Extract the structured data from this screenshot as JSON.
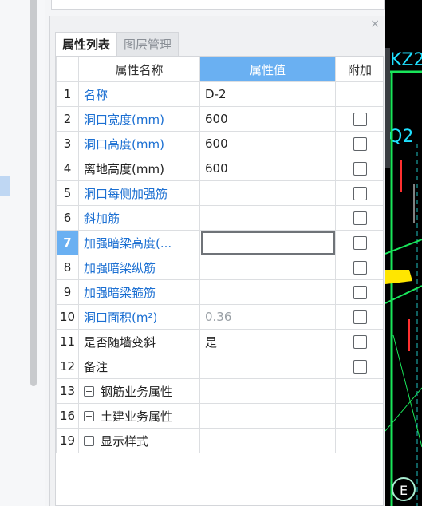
{
  "panel": {
    "tabs": [
      {
        "label": "属性列表",
        "active": true
      },
      {
        "label": "图层管理",
        "active": false
      }
    ],
    "close_label": "×"
  },
  "table": {
    "headers": {
      "name": "属性名称",
      "value": "属性值",
      "extra": "附加"
    },
    "rows": [
      {
        "idx": "1",
        "name": "名称",
        "value": "D-2"
      },
      {
        "idx": "2",
        "name": "洞口宽度(mm)",
        "value": "600"
      },
      {
        "idx": "3",
        "name": "洞口高度(mm)",
        "value": "600"
      },
      {
        "idx": "4",
        "name": "离地高度(mm)",
        "value": "600"
      },
      {
        "idx": "5",
        "name": "洞口每侧加强筋",
        "value": ""
      },
      {
        "idx": "6",
        "name": "斜加筋",
        "value": ""
      },
      {
        "idx": "7",
        "name": "加强暗梁高度(...",
        "value": ""
      },
      {
        "idx": "8",
        "name": "加强暗梁纵筋",
        "value": ""
      },
      {
        "idx": "9",
        "name": "加强暗梁箍筋",
        "value": ""
      },
      {
        "idx": "10",
        "name": "洞口面积(m²)",
        "value": "0.36"
      },
      {
        "idx": "11",
        "name": "是否随墙变斜",
        "value": "是"
      },
      {
        "idx": "12",
        "name": "备注",
        "value": ""
      },
      {
        "idx": "13",
        "name": "钢筋业务属性",
        "value": ""
      },
      {
        "idx": "16",
        "name": "土建业务属性",
        "value": ""
      },
      {
        "idx": "19",
        "name": "显示样式",
        "value": ""
      }
    ],
    "expand_symbol": "+"
  },
  "cad": {
    "label_top": "KZ2",
    "label_mid": "Q2",
    "circle_label": "E"
  },
  "colors": {
    "header_accent": "#6ab0f2",
    "link_blue": "#1b6fd2",
    "cad_green": "#19e65a"
  }
}
